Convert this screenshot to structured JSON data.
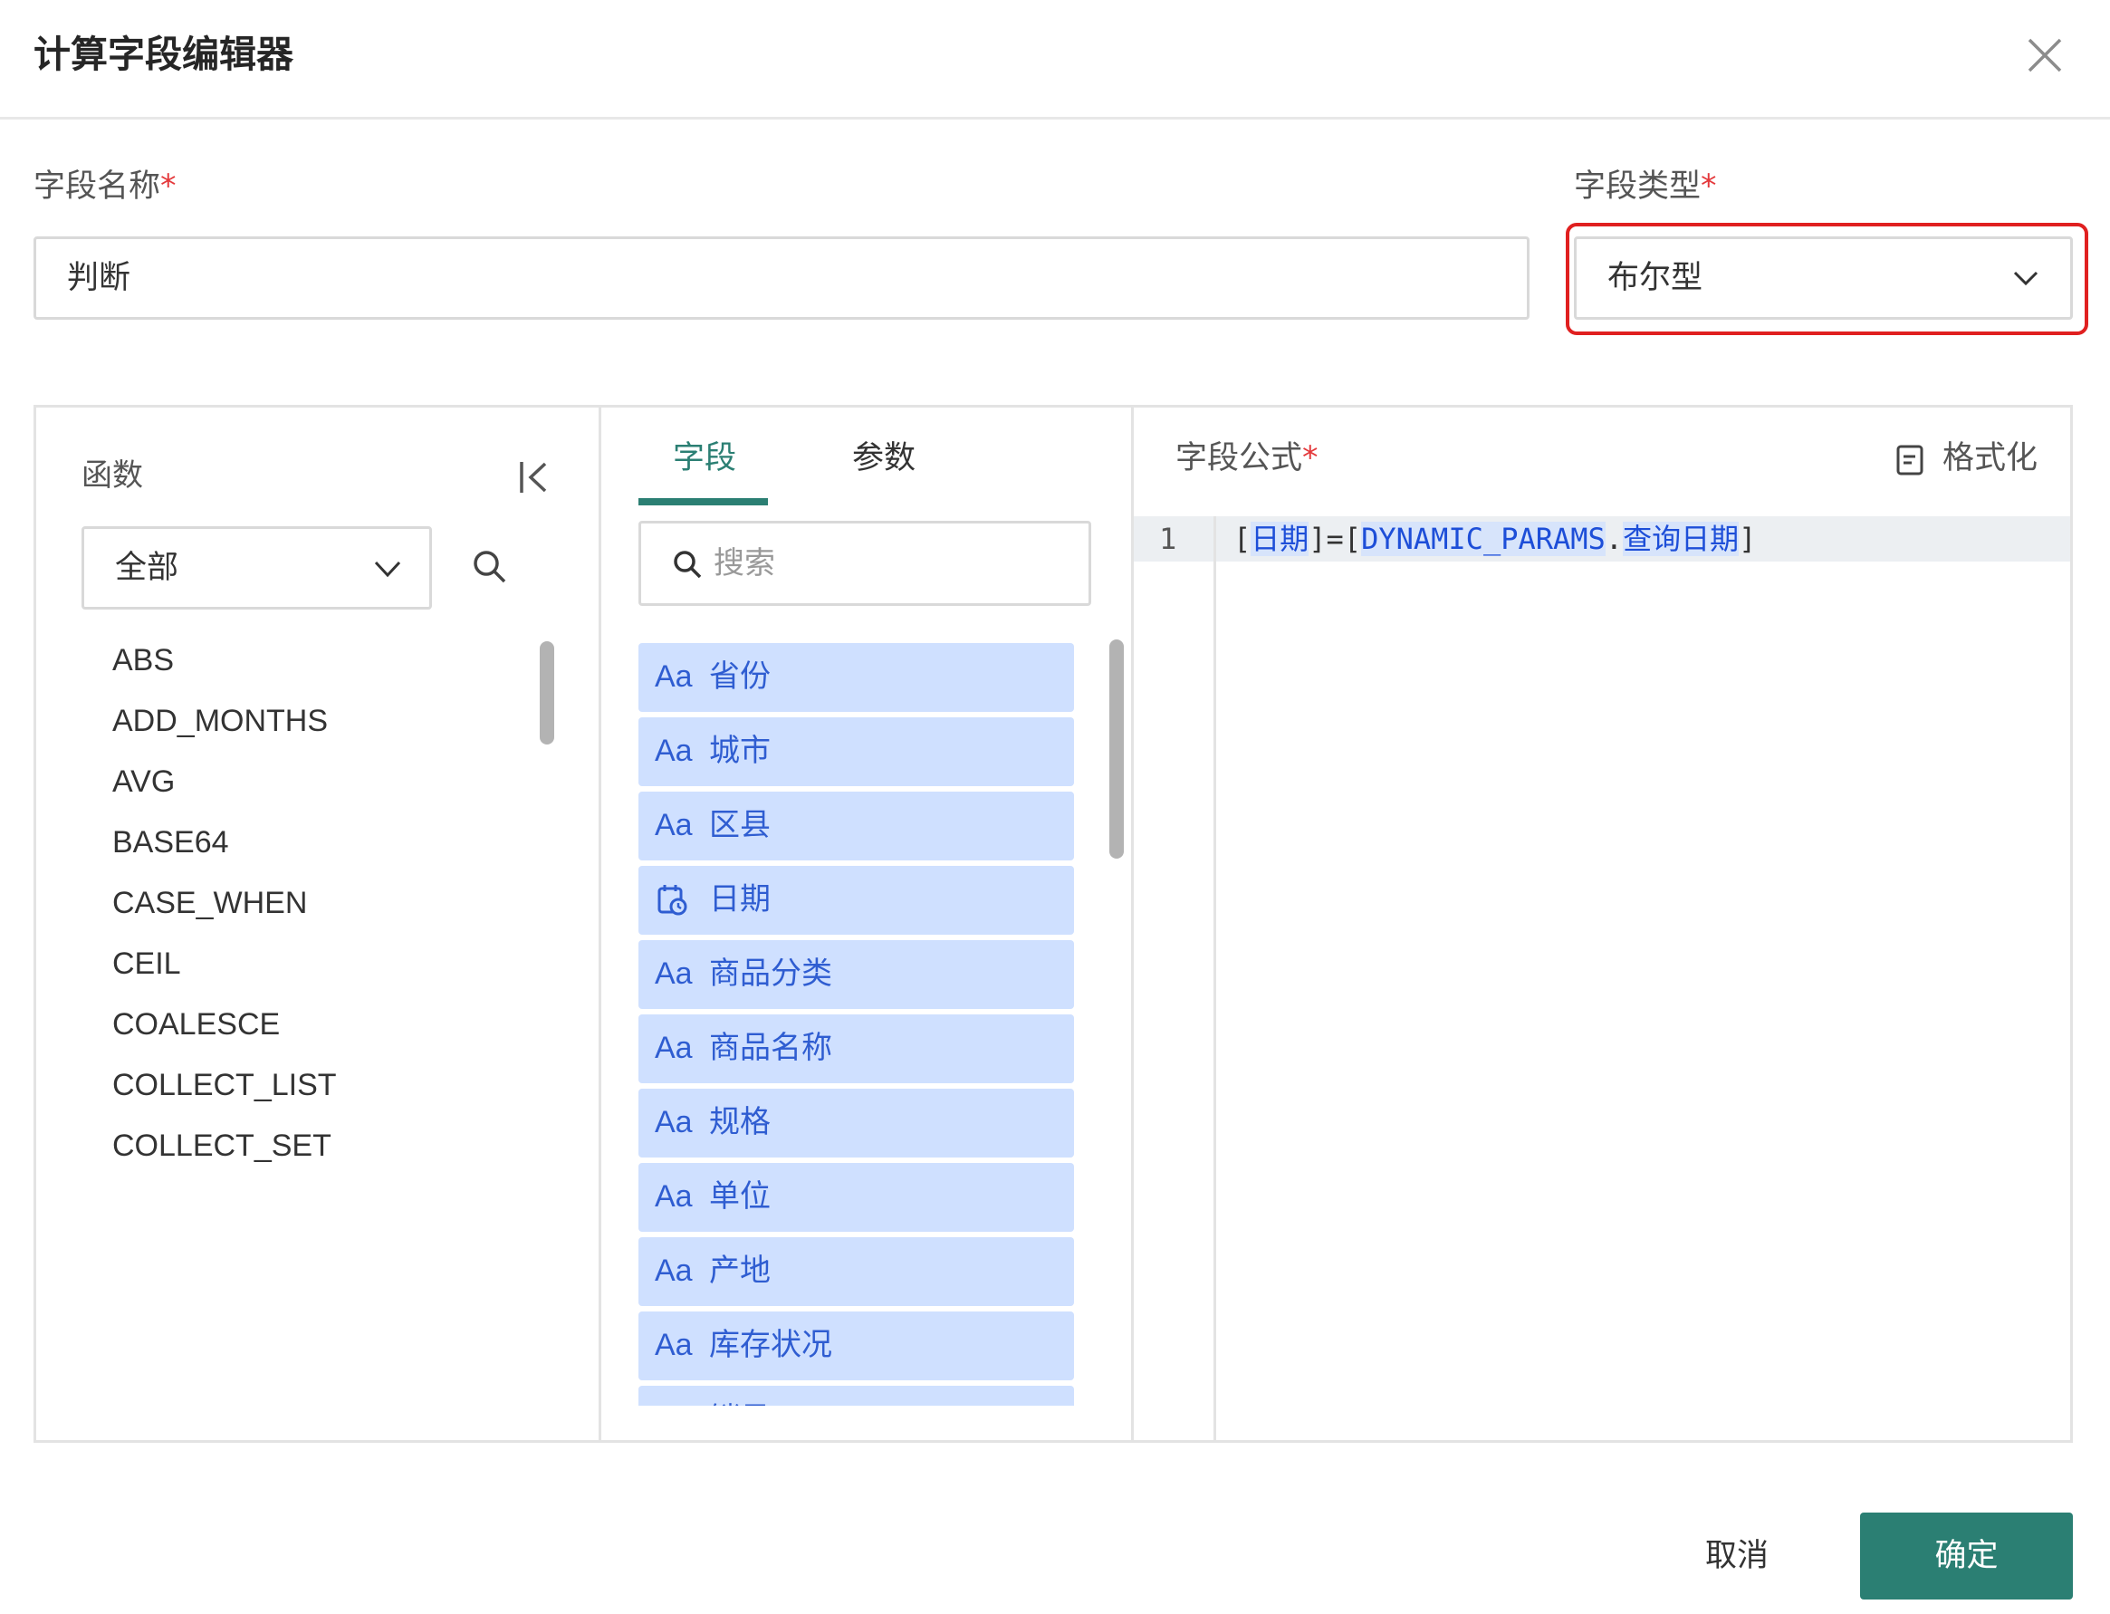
{
  "dialog": {
    "title": "计算字段编辑器"
  },
  "form": {
    "name_label": "字段名称",
    "name_value": "判断",
    "type_label": "字段类型",
    "type_value": "布尔型",
    "required_mark": "*"
  },
  "functions": {
    "title": "函数",
    "category": "全部",
    "items": [
      "ABS",
      "ADD_MONTHS",
      "AVG",
      "BASE64",
      "CASE_WHEN",
      "CEIL",
      "COALESCE",
      "COLLECT_LIST",
      "COLLECT_SET"
    ]
  },
  "fields_panel": {
    "tabs": [
      "字段",
      "参数"
    ],
    "active_tab": "字段",
    "search_placeholder": "搜索",
    "items": [
      {
        "type": "Aa",
        "name": "省份"
      },
      {
        "type": "Aa",
        "name": "城市"
      },
      {
        "type": "Aa",
        "name": "区县"
      },
      {
        "type": "date",
        "name": "日期"
      },
      {
        "type": "Aa",
        "name": "商品分类"
      },
      {
        "type": "Aa",
        "name": "商品名称"
      },
      {
        "type": "Aa",
        "name": "规格"
      },
      {
        "type": "Aa",
        "name": "单位"
      },
      {
        "type": "Aa",
        "name": "产地"
      },
      {
        "type": "Aa",
        "name": "库存状况"
      },
      {
        "type": "Aa",
        "name": "销量"
      }
    ]
  },
  "formula": {
    "label": "字段公式",
    "format_label": "格式化",
    "line_number": "1",
    "tokens": {
      "open1": "[",
      "ref1": "日期",
      "mid": "]=[",
      "ref2": "DYNAMIC_PARAMS",
      "dot": ".",
      "ref3": "查询日期",
      "close": "]"
    }
  },
  "footer": {
    "cancel_label": "取消",
    "ok_label": "确定"
  },
  "colors": {
    "accent": "#2b7f73",
    "field_bg": "#cfe0ff",
    "field_text": "#2f5dd1",
    "highlight": "#e02020",
    "required": "#e4393c"
  }
}
